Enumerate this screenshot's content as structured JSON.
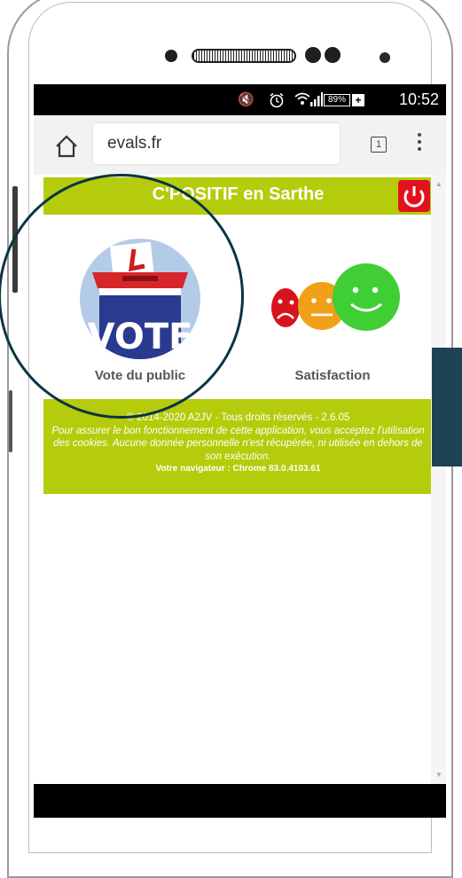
{
  "status_bar": {
    "battery": "89%",
    "time": "10:52"
  },
  "browser": {
    "url": "evals.fr",
    "tab_count": "1"
  },
  "app": {
    "title": "C'POSITIF en Sarthe",
    "tiles": [
      {
        "label": "Vote du public",
        "icon": "vote-box-icon",
        "badge_text": "VOTE"
      },
      {
        "label": "Satisfaction",
        "icon": "smileys-icon"
      }
    ]
  },
  "footer": {
    "copyright": "© 2014-2020 A2JV - Tous droits réservés - 2.6.05",
    "notice": "Pour assurer le bon fonctionnement de cette application, vous acceptez l'utilisation des cookies. Aucune donnée personnelle n'est récupérée, ni utilisée en dehors de son exécution.",
    "browser_info": "Votre navigateur : Chrome 83.0.4103.61"
  },
  "colors": {
    "accent": "#b4cc0b",
    "power": "#e1121b",
    "annotation": "#0b3445"
  }
}
